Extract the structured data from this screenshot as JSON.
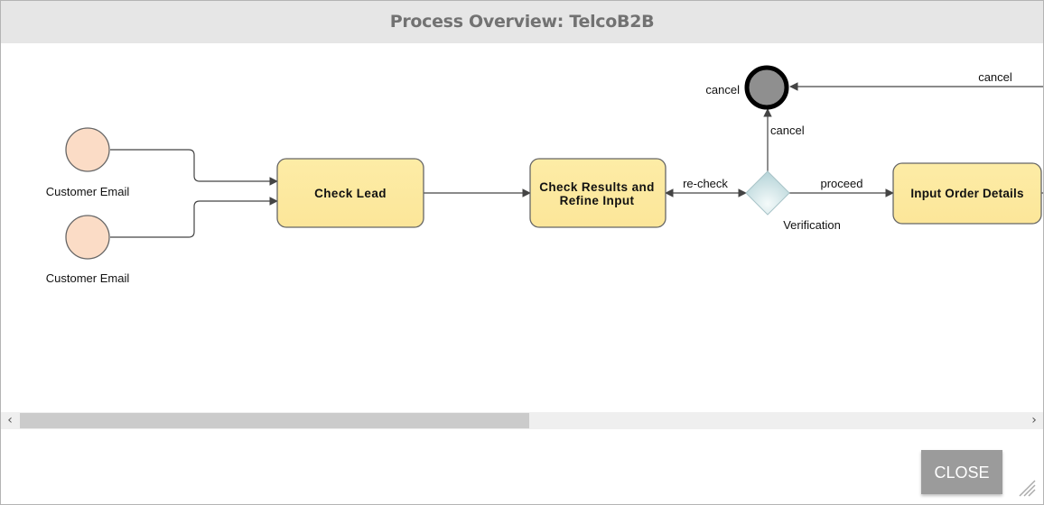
{
  "dialog": {
    "title": "Process Overview: TelcoB2B",
    "close_label": "CLOSE"
  },
  "colors": {
    "titlebar_bg": "#e6e6e6",
    "title_text": "#727272",
    "task_fill": "#fdeba0",
    "start_event_fill": "#fbdcc6",
    "end_event_fill": "#8f8f8f",
    "gateway_fill": "#c6dfe2",
    "close_button_bg": "#9b9b9b",
    "scroll_thumb": "#cbcbcb"
  },
  "diagram": {
    "start_events": [
      {
        "label": "Customer Email"
      },
      {
        "label": "Customer Email"
      }
    ],
    "tasks": [
      {
        "label_lines": [
          "Check Lead"
        ]
      },
      {
        "label_lines": [
          "Check Results and",
          "Refine Input"
        ]
      },
      {
        "label_lines": [
          "Input Order Details"
        ]
      }
    ],
    "gateway": {
      "label": "Verification"
    },
    "end_event": {
      "label": "cancel"
    },
    "flows": [
      {
        "from": "Customer Email",
        "to": "Check Lead",
        "label": ""
      },
      {
        "from": "Customer Email",
        "to": "Check Lead",
        "label": ""
      },
      {
        "from": "Check Lead",
        "to": "Check Results and Refine Input",
        "label": ""
      },
      {
        "from": "Verification",
        "to": "Check Results and Refine Input",
        "label": "re-check"
      },
      {
        "from": "Verification",
        "to": "Input Order Details",
        "label": "proceed"
      },
      {
        "from": "Verification",
        "to": "cancel",
        "label": "cancel"
      },
      {
        "from": "offscreen",
        "to": "cancel",
        "label": "cancel"
      }
    ]
  },
  "scrollbar": {
    "left_icon": "chevron-left-icon",
    "right_icon": "chevron-right-icon",
    "left_glyph": "‹",
    "right_glyph": "›",
    "visible_fraction": 0.49
  }
}
